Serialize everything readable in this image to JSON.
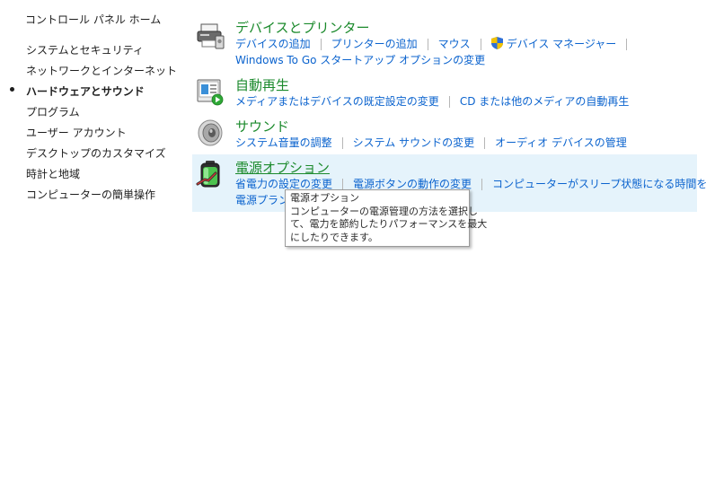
{
  "sidebar": {
    "home": "コントロール パネル ホーム",
    "items": [
      {
        "label": "システムとセキュリティ"
      },
      {
        "label": "ネットワークとインターネット"
      },
      {
        "label": "ハードウェアとサウンド",
        "active": true
      },
      {
        "label": "プログラム"
      },
      {
        "label": "ユーザー アカウント"
      },
      {
        "label": "デスクトップのカスタマイズ"
      },
      {
        "label": "時計と地域"
      },
      {
        "label": "コンピューターの簡単操作"
      }
    ]
  },
  "categories": {
    "devices": {
      "title": "デバイスとプリンター",
      "icon": "printer-icon",
      "links": [
        "デバイスの追加",
        "プリンターの追加",
        "マウス",
        "デバイス マネージャー",
        "Windows To Go スタートアップ オプションの変更"
      ]
    },
    "autoplay": {
      "title": "自動再生",
      "icon": "autoplay-icon",
      "links": [
        "メディアまたはデバイスの既定設定の変更",
        "CD または他のメディアの自動再生"
      ]
    },
    "sound": {
      "title": "サウンド",
      "icon": "speaker-icon",
      "links": [
        "システム音量の調整",
        "システム サウンドの変更",
        "オーディオ デバイスの管理"
      ]
    },
    "power": {
      "title": "電源オプション",
      "icon": "battery-icon",
      "links": [
        "省電力の設定の変更",
        "電源ボタンの動作の変更",
        "コンピューターがスリープ状態になる時間を変更",
        "電源プランの"
      ]
    }
  },
  "tooltip": {
    "title": "電源オプション",
    "lines": [
      "コンピューターの電源管理の方法を選択し",
      "て、電力を節約したりパフォーマンスを最大",
      "にしたりできます。"
    ]
  },
  "colors": {
    "category_title": "#1b8a2c",
    "link": "#0b63ce",
    "hover_bg": "#e5f3fb"
  }
}
